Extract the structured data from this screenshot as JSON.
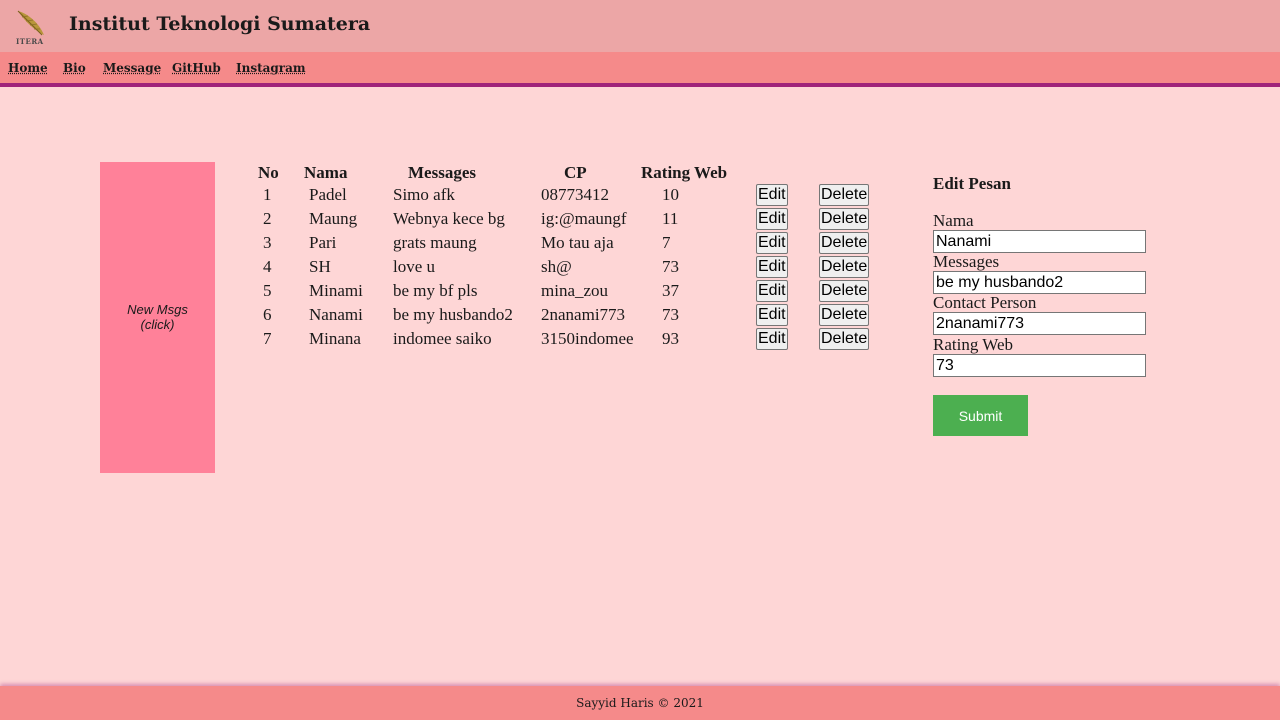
{
  "header": {
    "logo_text": "ITERA",
    "title": "Institut Teknologi Sumatera"
  },
  "nav": {
    "items": [
      "Home",
      "Bio",
      "Message",
      "GitHub",
      "Instagram"
    ]
  },
  "side_box": {
    "line1": "New Msgs",
    "line2": "(click)"
  },
  "table": {
    "headers": [
      "No",
      "Nama",
      "Messages",
      "CP",
      "Rating Web"
    ],
    "rows": [
      {
        "no": "1",
        "nama": "Padel",
        "message": "Simo afk",
        "cp": "08773412",
        "rating": "10"
      },
      {
        "no": "2",
        "nama": "Maung",
        "message": "Webnya kece bg",
        "cp": "ig:@maungf",
        "rating": "11"
      },
      {
        "no": "3",
        "nama": "Pari",
        "message": "grats maung",
        "cp": "Mo tau aja",
        "rating": "7"
      },
      {
        "no": "4",
        "nama": "SH",
        "message": "love u",
        "cp": "sh@",
        "rating": "73"
      },
      {
        "no": "5",
        "nama": "Minami",
        "message": "be my bf pls",
        "cp": "mina_zou",
        "rating": "37"
      },
      {
        "no": "6",
        "nama": "Nanami",
        "message": "be my husbando2",
        "cp": "2nanami773",
        "rating": "73"
      },
      {
        "no": "7",
        "nama": "Minana",
        "message": "indomee saiko",
        "cp": "3150indomee",
        "rating": "93"
      }
    ],
    "edit_label": "Edit",
    "delete_label": "Delete"
  },
  "form": {
    "title": "Edit Pesan",
    "nama_label": "Nama",
    "nama_value": "Nanami",
    "messages_label": "Messages",
    "messages_value": "be my husbando2",
    "cp_label": "Contact Person",
    "cp_value": "2nanami773",
    "rating_label": "Rating Web",
    "rating_value": "73",
    "submit_label": "Submit"
  },
  "footer": {
    "text": "Sayyid Haris © 2021"
  },
  "colors": {
    "page_bg": "#fed6d6",
    "header_bg": "#eca6a6",
    "nav_bg": "#f58a8a",
    "nav_border": "#a0237a",
    "side_box": "#ff8199",
    "submit": "#4caf50"
  }
}
